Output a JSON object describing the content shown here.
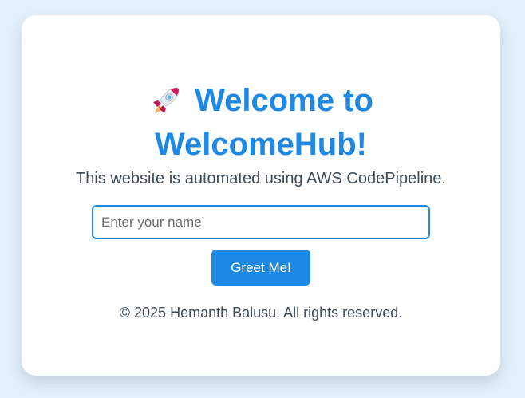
{
  "page": {
    "background_color": "#e3f0fc",
    "accent_color": "#1e88e5"
  },
  "header": {
    "icon": "rocket-icon",
    "title_line1": "Welcome to",
    "title_line2": "WelcomeHub!"
  },
  "main": {
    "subtitle": "This website is automated using AWS CodePipeline.",
    "name_input": {
      "value": "",
      "placeholder": "Enter your name"
    },
    "greet_button_label": "Greet Me!"
  },
  "footer": {
    "text": "© 2025 Hemanth Balusu. All rights reserved."
  }
}
